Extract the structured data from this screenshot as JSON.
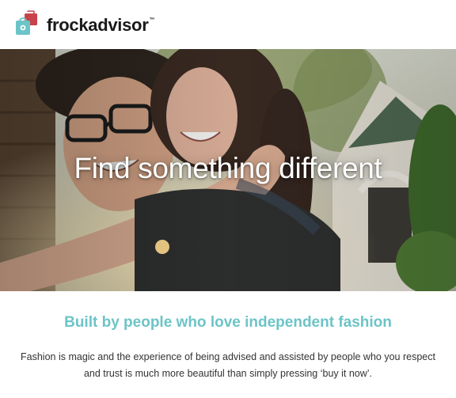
{
  "brand": {
    "name": "frockadvisor",
    "trademark": "™",
    "accent_color": "#6cc4c7",
    "bag_color": "#c9434b"
  },
  "hero": {
    "headline": "Find something different",
    "image": "photo of a smiling couple, woman riding piggyback on a man with glasses, sunny street with trees and houses"
  },
  "intro": {
    "heading": "Built by people who love independent fashion",
    "heading_color": "#6cc4c7",
    "body": "Fashion is magic and the experience of being advised and assisted by people who you respect and trust is much more beautiful than simply pressing ‘buy it now’."
  }
}
